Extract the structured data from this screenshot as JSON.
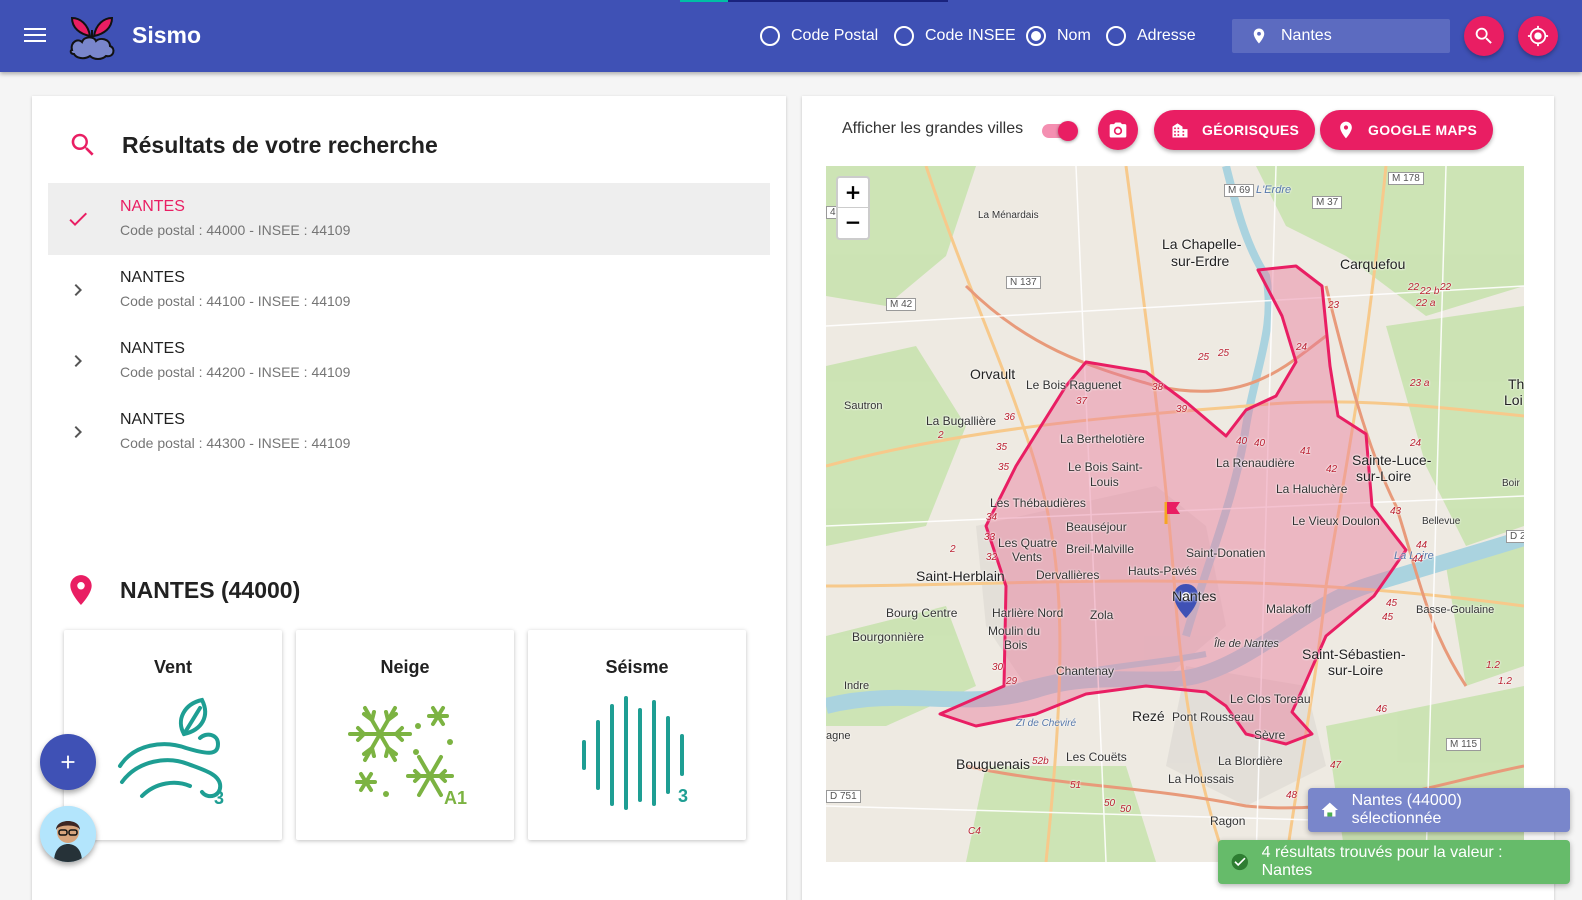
{
  "app": {
    "name": "Sismo"
  },
  "header": {
    "search_modes": [
      {
        "label": "Code Postal",
        "selected": false
      },
      {
        "label": "Code INSEE",
        "selected": false
      },
      {
        "label": "Nom",
        "selected": true
      },
      {
        "label": "Adresse",
        "selected": false
      }
    ],
    "search_value": "Nantes",
    "icons": [
      "menu-icon",
      "search-icon",
      "gps-icon",
      "location-pin-icon"
    ]
  },
  "results": {
    "title": "Résultats de votre recherche",
    "items": [
      {
        "name": "NANTES",
        "detail": "Code postal : 44000 - INSEE : 44109",
        "selected": true
      },
      {
        "name": "NANTES",
        "detail": "Code postal : 44100 - INSEE : 44109",
        "selected": false
      },
      {
        "name": "NANTES",
        "detail": "Code postal : 44200 - INSEE : 44109",
        "selected": false
      },
      {
        "name": "NANTES",
        "detail": "Code postal : 44300 - INSEE : 44109",
        "selected": false
      }
    ]
  },
  "city": {
    "title": "NANTES (44000)",
    "risks": [
      {
        "label": "Vent",
        "level": "3",
        "icon": "wind-icon"
      },
      {
        "label": "Neige",
        "level": "A1",
        "icon": "snowflake-icon"
      },
      {
        "label": "Séisme",
        "level": "3",
        "icon": "seismic-wave-icon"
      }
    ]
  },
  "map_toolbar": {
    "toggle_label": "Afficher les grandes villes",
    "toggle_on": true,
    "georisques_label": "GÉORISQUES",
    "google_maps_label": "GOOGLE MAPS"
  },
  "map": {
    "zoom_in": "+",
    "zoom_out": "−",
    "labels": {
      "chapelle1": "La Chapelle-",
      "chapelle2": "sur-Erdre",
      "carquefou": "Carquefou",
      "orvault": "Orvault",
      "menardais": "La Ménardais",
      "sautron": "Sautron",
      "raguenet": "Le Bois Raguenet",
      "bugalliere": "La Bugallière",
      "berthelotiere": "La Berthelotière",
      "renaudiere": "La Renaudière",
      "saintluce1": "Sainte-Luce-",
      "saintluce2": "sur-Loire",
      "haluchere": "La Haluchère",
      "boissaint1": "Le Bois Saint-",
      "boissaint2": "Louis",
      "thebaudieres": "Les Thébaudières",
      "vieuxdoulon": "Le Vieux Doulon",
      "beausejour": "Beauséjour",
      "quatrevents1": "Les Quatre",
      "quatrevents2": "Vents",
      "breil": "Breil-Malville",
      "saintdonatien": "Saint-Donatien",
      "herblain": "Saint-Herblain",
      "dervallieres": "Dervallières",
      "hautspaves": "Hauts-Pavés",
      "nantes": "Nantes",
      "bourgcentre": "Bourg Centre",
      "bourgonniere": "Bourgonnière",
      "harliere": "Harlière Nord",
      "zola": "Zola",
      "malakoff": "Malakoff",
      "moulin1": "Moulin du",
      "moulin2": "Bois",
      "iledenantes": "Île de Nantes",
      "sebastien1": "Saint-Sébastien-",
      "sebastien2": "sur-Loire",
      "basse": "Basse-Goulaine",
      "chantenay": "Chantenay",
      "indre": "Indre",
      "clostoreau": "Le Clos Toreau",
      "ziche": "ZI de Cheviré",
      "reze": "Rezé",
      "pontrousseau": "Pont Rousseau",
      "sevre": "Sèvre",
      "agne": "agne",
      "bouguenais": "Bouguenais",
      "couets": "Les Couëts",
      "blordiere": "La Blordière",
      "houssais": "La Houssais",
      "ragon": "Ragon",
      "bellevue": "Bellevue",
      "thouare1": "Thouar",
      "thouare2": "Loi",
      "erdre": "L'Erdre",
      "loire": "La Loire",
      "boir": "Boir"
    },
    "roads": {
      "m69": "M 69",
      "m37": "M 37",
      "m178": "M 178",
      "n137": "N 137",
      "m42": "M 42",
      "m115": "M 115",
      "d751": "D 751",
      "d2": "D 2",
      "r42": "42"
    },
    "exits": [
      "23",
      "22",
      "22 b",
      "22",
      "22 a",
      "23 a",
      "24",
      "25",
      "25",
      "24",
      "38",
      "37",
      "36",
      "35",
      "35",
      "34",
      "33",
      "32",
      "2",
      "2",
      "40",
      "40",
      "41",
      "42",
      "43",
      "44",
      "44",
      "45",
      "45",
      "46",
      "47",
      "48",
      "1.2",
      "1.2",
      "30",
      "29",
      "51",
      "50",
      "50",
      "52b",
      "C4",
      "39"
    ]
  },
  "toasts": {
    "info": "Nantes (44000) sélectionnée",
    "success": "4 résultats trouvés pour la valeur : Nantes"
  }
}
